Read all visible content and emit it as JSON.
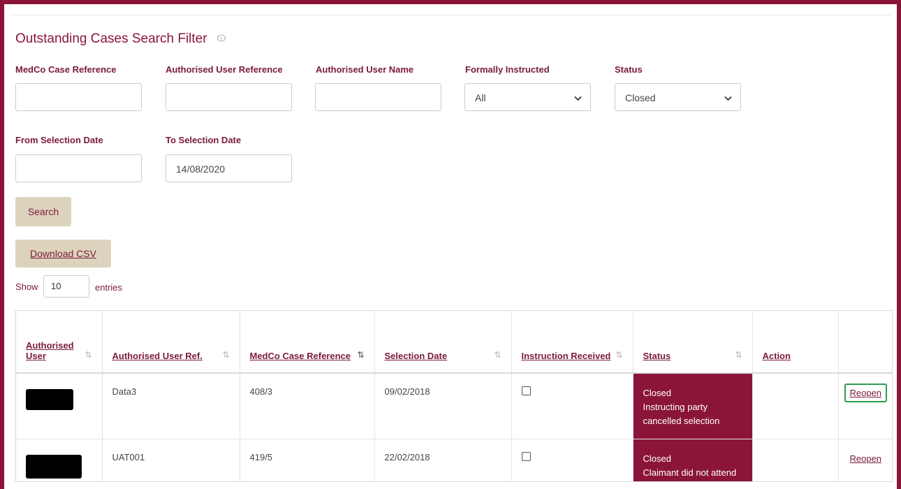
{
  "filter": {
    "title": "Outstanding Cases Search Filter",
    "help_icon": "info-icon",
    "fields": {
      "medco_case_reference": {
        "label": "MedCo Case Reference",
        "value": ""
      },
      "authorised_user_reference": {
        "label": "Authorised User Reference",
        "value": ""
      },
      "authorised_user_name": {
        "label": "Authorised User Name",
        "value": ""
      },
      "formally_instructed": {
        "label": "Formally Instructed",
        "selected": "All"
      },
      "status": {
        "label": "Status",
        "selected": "Closed"
      },
      "from_selection_date": {
        "label": "From Selection Date",
        "value": ""
      },
      "to_selection_date": {
        "label": "To Selection Date",
        "value": "14/08/2020"
      }
    },
    "search_label": "Search",
    "download_label": "Download CSV"
  },
  "length": {
    "show_label": "Show",
    "value": "10",
    "entries_label": "entries"
  },
  "table": {
    "headers": [
      "Authorised User",
      "Authorised User Ref.",
      "MedCo Case Reference",
      "Selection Date",
      "Instruction Received",
      "Status",
      "Action",
      ""
    ],
    "rows": [
      {
        "user": "[redacted]",
        "ref": "Data3",
        "case_ref": "408/3",
        "date": "09/02/2018",
        "instruction_received": false,
        "status_line1": "Closed",
        "status_line2": "Instructing party cancelled selection",
        "action": "Reopen"
      },
      {
        "user": "[redacted]",
        "ref": "UAT001",
        "case_ref": "419/5",
        "date": "22/02/2018",
        "instruction_received": false,
        "status_line1": "Closed",
        "status_line2": "Claimant did not attend",
        "action": "Reopen"
      }
    ]
  },
  "colors": {
    "brand": "#8a1538",
    "button_bg": "#ddd3bc",
    "highlight": "#2e9c4c"
  }
}
